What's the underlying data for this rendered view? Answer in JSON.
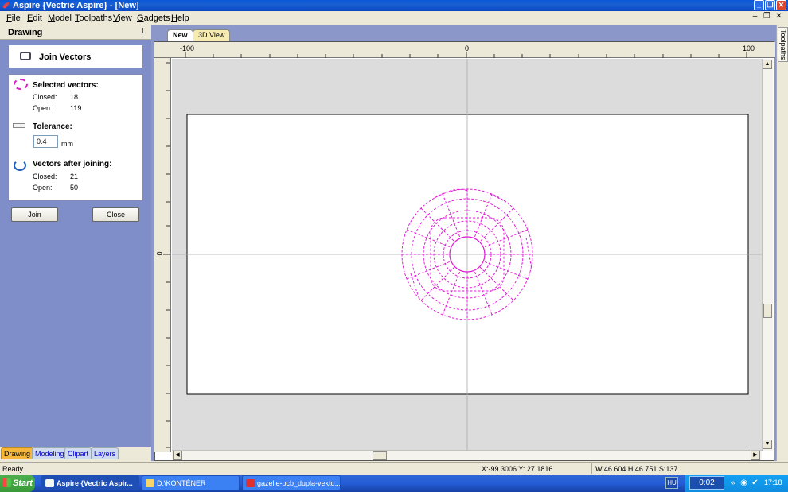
{
  "window": {
    "title": "Aspire {Vectric Aspire} - [New]"
  },
  "menu": [
    "File",
    "Edit",
    "Model",
    "Toolpaths",
    "View",
    "Gadgets",
    "Help"
  ],
  "panel": {
    "header": "Drawing",
    "tool_title": "Join Vectors",
    "selected_heading": "Selected vectors:",
    "closed_label": "Closed:",
    "open_label": "Open:",
    "selected_closed": "18",
    "selected_open": "119",
    "tolerance_heading": "Tolerance:",
    "tolerance_value": "0.4",
    "tolerance_unit": "mm",
    "after_heading": "Vectors after joining:",
    "after_closed": "21",
    "after_open": "50",
    "join_button": "Join",
    "close_button": "Close"
  },
  "bottom_tabs": [
    "Drawing",
    "Modeling",
    "Clipart",
    "Layers"
  ],
  "doc_tabs": {
    "new": "New",
    "view3d": "3D View"
  },
  "ruler": {
    "top_labels": [
      "-100",
      "0",
      "100"
    ],
    "left_labels": [
      "0"
    ]
  },
  "side_tab": "Toolpaths",
  "status": {
    "ready": "Ready",
    "coords": "X:-99.3006 Y: 27.1816",
    "dims": "W:46.604  H:46.751  S:137"
  },
  "taskbar": {
    "start": "Start",
    "items": [
      "Aspire {Vectric Aspir...",
      "D:\\KONTÉNER",
      "gazelle-pcb_dupla-vekto..."
    ],
    "lang": "HU",
    "timer": "0:02",
    "clock": "17:18"
  },
  "colors": {
    "vectors": "#e020d8",
    "accent": "#f6b63a"
  }
}
